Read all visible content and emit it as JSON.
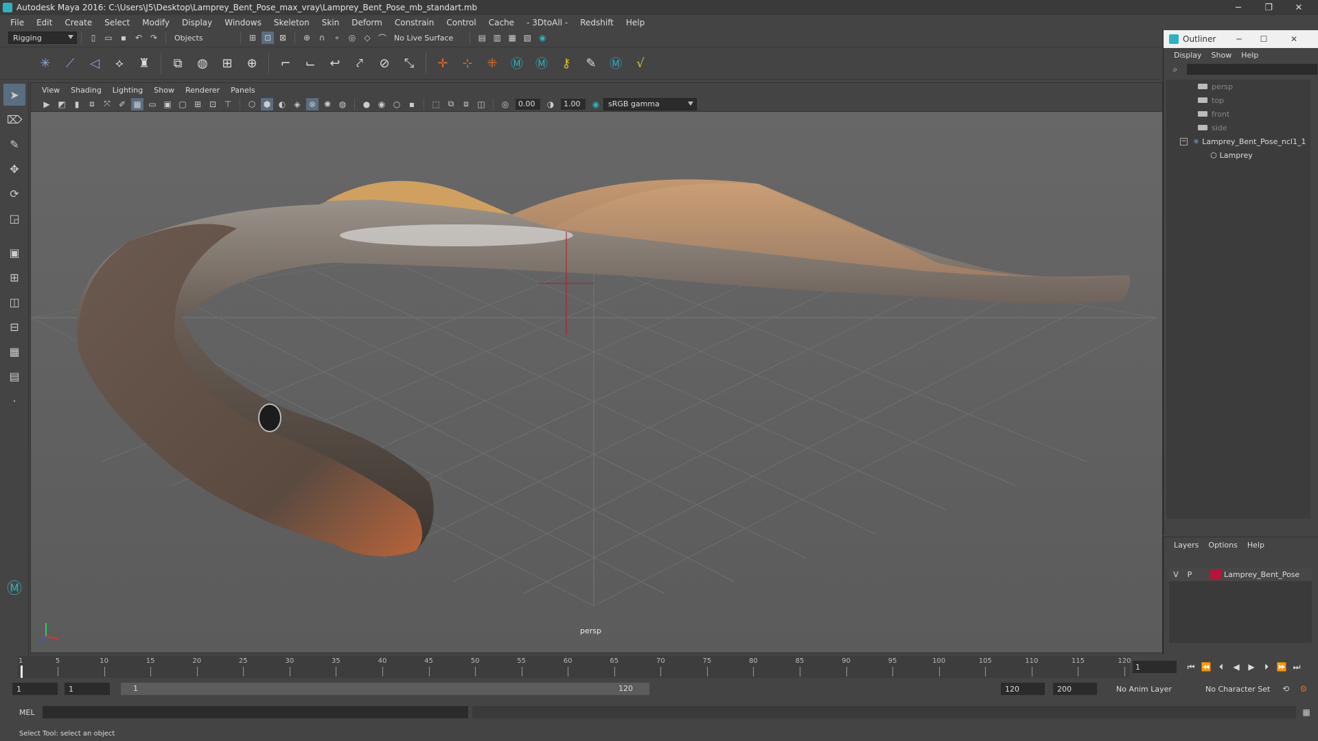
{
  "window": {
    "title": "Autodesk Maya 2016: C:\\Users\\J5\\Desktop\\Lamprey_Bent_Pose_max_vray\\Lamprey_Bent_Pose_mb_standart.mb",
    "controls": {
      "minimize": "─",
      "restore": "❐",
      "close": "✕"
    }
  },
  "menubar": [
    "File",
    "Edit",
    "Create",
    "Select",
    "Modify",
    "Display",
    "Windows",
    "Skeleton",
    "Skin",
    "Deform",
    "Constrain",
    "Control",
    "Cache",
    "- 3DtoAll -",
    "Redshift",
    "Help"
  ],
  "statusline": {
    "menuset": "Rigging",
    "selection_mode": "Objects",
    "live_surface": "No Live Surface"
  },
  "viewport": {
    "menu": [
      "View",
      "Shading",
      "Lighting",
      "Show",
      "Renderer",
      "Panels"
    ],
    "exposure": "0.00",
    "gamma": "1.00",
    "color_space": "sRGB gamma",
    "camera": "persp"
  },
  "outliner": {
    "title": "Outliner",
    "menu": [
      "Display",
      "Show",
      "Help"
    ],
    "items": [
      {
        "label": "persp",
        "type": "camera"
      },
      {
        "label": "top",
        "type": "camera"
      },
      {
        "label": "front",
        "type": "camera"
      },
      {
        "label": "side",
        "type": "camera"
      },
      {
        "label": "Lamprey_Bent_Pose_ncl1_1",
        "type": "group"
      },
      {
        "label": "Lamprey",
        "type": "mesh"
      }
    ]
  },
  "layers": {
    "menu": [
      "Layers",
      "Options",
      "Help"
    ],
    "rows": [
      {
        "v": "V",
        "p": "P",
        "name": "Lamprey_Bent_Pose",
        "color": "#b8143a"
      }
    ]
  },
  "timeline": {
    "ticks": [
      "1",
      "5",
      "10",
      "15",
      "20",
      "25",
      "30",
      "35",
      "40",
      "45",
      "50",
      "55",
      "60",
      "65",
      "70",
      "75",
      "80",
      "85",
      "90",
      "95",
      "100",
      "105",
      "110",
      "115",
      "120"
    ],
    "current_frame": "1"
  },
  "range": {
    "start": "1",
    "playback_start": "1",
    "slider_start": "1",
    "slider_end": "120",
    "playback_end": "120",
    "end": "200",
    "anim_layer": "No Anim Layer",
    "character_set": "No Character Set"
  },
  "commandline": {
    "label": "MEL"
  },
  "helpline": {
    "text": "Select Tool: select an object"
  }
}
